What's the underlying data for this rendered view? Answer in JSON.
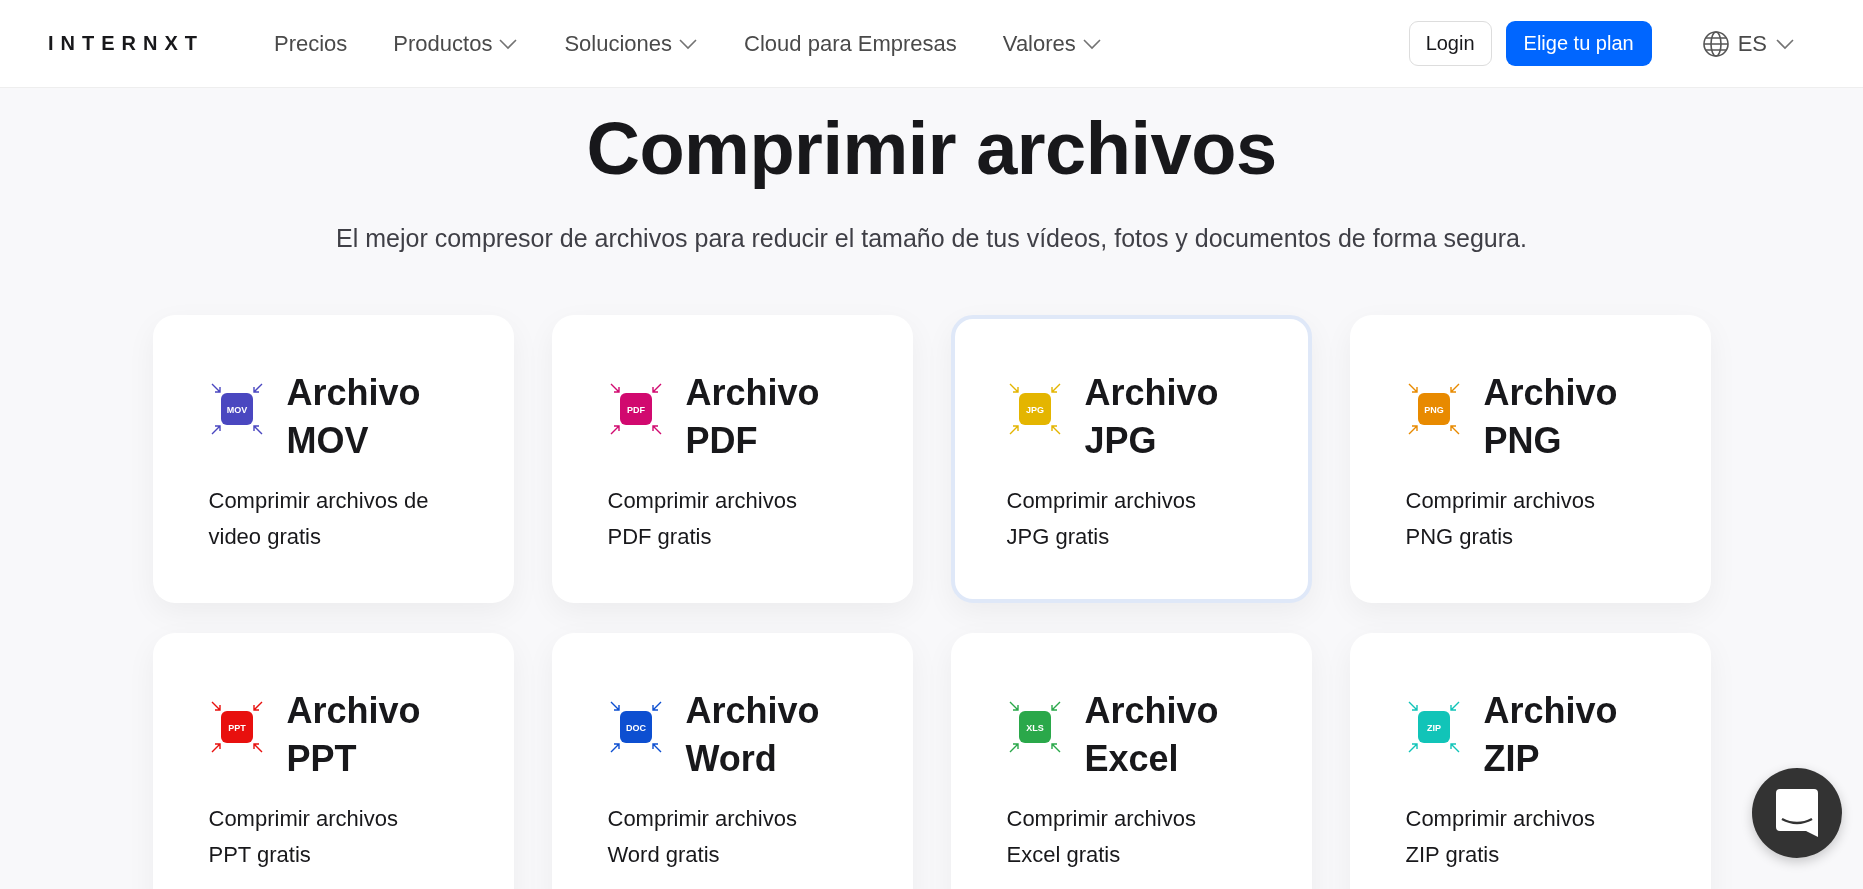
{
  "header": {
    "logo": "INTERNXT",
    "nav": [
      {
        "label": "Precios",
        "dropdown": false
      },
      {
        "label": "Productos",
        "dropdown": true
      },
      {
        "label": "Soluciones",
        "dropdown": true
      },
      {
        "label": "Cloud para Empresas",
        "dropdown": false
      },
      {
        "label": "Valores",
        "dropdown": true
      }
    ],
    "login": "Login",
    "cta": "Elige tu plan",
    "language": "ES"
  },
  "hero": {
    "title": "Comprimir archivos",
    "subtitle": "El mejor compresor de archivos para reducir el tamaño de tus vídeos, fotos y documentos de forma segura."
  },
  "cards": [
    {
      "badge": "MOV",
      "color": "#4a47c0",
      "title": "Archivo MOV",
      "description": "Comprimir archivos de video gratis",
      "selected": false
    },
    {
      "badge": "PDF",
      "color": "#d1096f",
      "title": "Archivo PDF",
      "description": "Comprimir archivos PDF gratis",
      "selected": false
    },
    {
      "badge": "JPG",
      "color": "#e4b500",
      "title": "Archivo JPG",
      "description": "Comprimir archivos JPG gratis",
      "selected": true
    },
    {
      "badge": "PNG",
      "color": "#e88a00",
      "title": "Archivo PNG",
      "description": "Comprimir archivos PNG gratis",
      "selected": false
    },
    {
      "badge": "PPT",
      "color": "#e8100e",
      "title": "Archivo PPT",
      "description": "Comprimir archivos PPT gratis",
      "selected": false
    },
    {
      "badge": "DOC",
      "color": "#0d4fd1",
      "title": "Archivo Word",
      "description": "Comprimir archivos Word gratis",
      "selected": false
    },
    {
      "badge": "XLS",
      "color": "#2aa84a",
      "title": "Archivo Excel",
      "description": "Comprimir archivos Excel gratis",
      "selected": false
    },
    {
      "badge": "ZIP",
      "color": "#11c4b8",
      "title": "Archivo ZIP",
      "description": "Comprimir archivos ZIP gratis",
      "selected": false
    }
  ]
}
